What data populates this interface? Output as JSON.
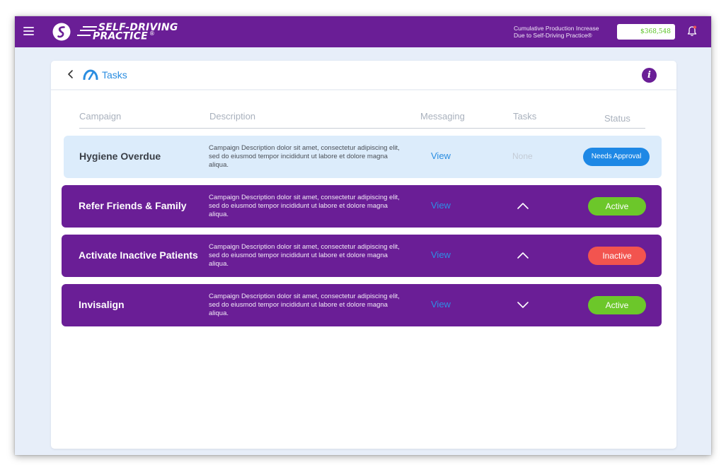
{
  "header": {
    "brand_line1": "SELF-DRIVING",
    "brand_line2": "PRACTICE",
    "brand_mark": "®",
    "production_label_line1": "Cumulative Production Increase",
    "production_label_line2": "Due to Self-Driving Practice®",
    "production_value": "$368,548",
    "menu_icon": "hamburger-icon",
    "bell_icon": "bell-icon"
  },
  "page": {
    "title": "Tasks",
    "back_icon": "chevron-left-icon",
    "title_icon": "gauge-icon",
    "info_icon_glyph": "i"
  },
  "table": {
    "columns": [
      "Campaign",
      "Description",
      "Messaging",
      "Tasks",
      "Status"
    ],
    "rows": [
      {
        "campaign": "Hygiene Overdue",
        "description": "Campaign Description dolor sit amet, consectetur adipiscing elit, sed do eiusmod tempor incididunt ut labore et dolore magna aliqua.",
        "messaging": "View",
        "tasks": "None",
        "status": "Needs Approval"
      },
      {
        "campaign": "Refer Friends & Family",
        "description": "Campaign Description dolor sit amet, consectetur adipiscing elit, sed do eiusmod tempor incididunt ut labore et dolore magna aliqua.",
        "messaging": "View",
        "tasks_icon": "chevron-up-icon",
        "status": "Active"
      },
      {
        "campaign": "Activate Inactive Patients",
        "description": "Campaign Description dolor sit amet, consectetur adipiscing elit, sed do eiusmod tempor incididunt ut labore et dolore magna aliqua.",
        "messaging": "View",
        "tasks_icon": "chevron-up-icon",
        "status": "Inactive"
      },
      {
        "campaign": "Invisalign",
        "description": "Campaign Description dolor sit amet, consectetur adipiscing elit, sed do eiusmod tempor incididunt ut labore et dolore magna aliqua.",
        "messaging": "View",
        "tasks_icon": "chevron-down-icon",
        "status": "Active"
      }
    ]
  },
  "colors": {
    "brand_purple": "#6a1e96",
    "link_blue": "#2a8de0",
    "active_green": "#6cc72a",
    "inactive_red": "#f2544f",
    "approval_blue": "#1e88e5",
    "highlight_row": "#dcecfb"
  }
}
